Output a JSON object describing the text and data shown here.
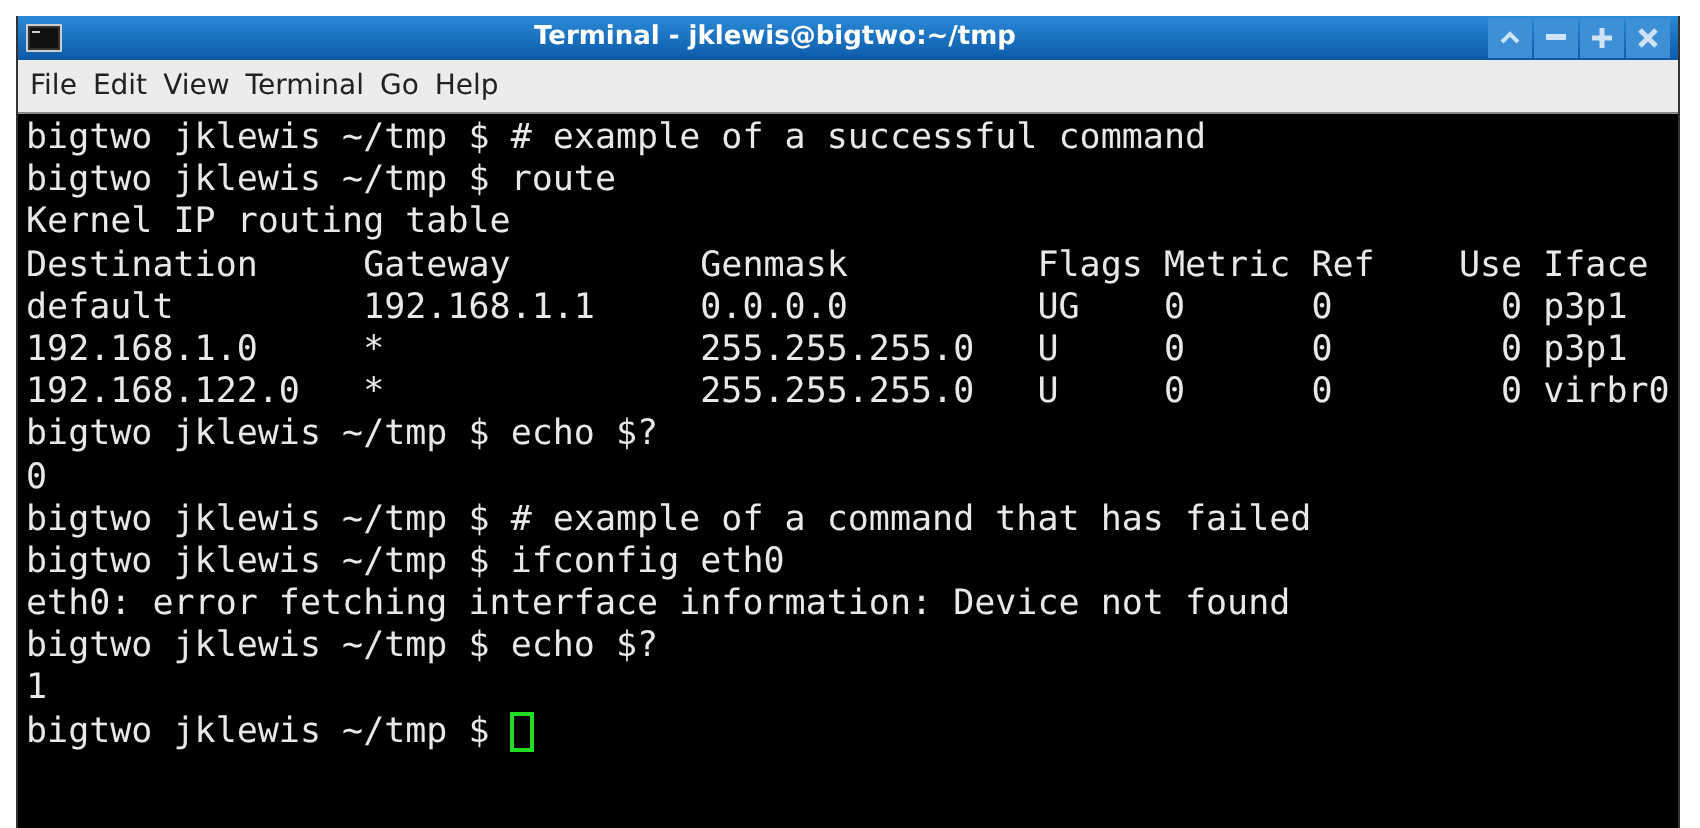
{
  "window": {
    "title": "Terminal - jklewis@bigtwo:~/tmp"
  },
  "menu": [
    "File",
    "Edit",
    "View",
    "Terminal",
    "Go",
    "Help"
  ],
  "terminal": {
    "lines": [
      "bigtwo jklewis ~/tmp $ # example of a successful command",
      "bigtwo jklewis ~/tmp $ route",
      "Kernel IP routing table",
      "Destination     Gateway         Genmask         Flags Metric Ref    Use Iface",
      "default         192.168.1.1     0.0.0.0         UG    0      0        0 p3p1",
      "192.168.1.0     *               255.255.255.0   U     0      0        0 p3p1",
      "192.168.122.0   *               255.255.255.0   U     0      0        0 virbr0",
      "bigtwo jklewis ~/tmp $ echo $?",
      "0",
      "bigtwo jklewis ~/tmp $ # example of a command that has failed",
      "bigtwo jklewis ~/tmp $ ifconfig eth0",
      "eth0: error fetching interface information: Device not found",
      "bigtwo jklewis ~/tmp $ echo $?",
      "1"
    ],
    "prompt": "bigtwo jklewis ~/tmp $"
  }
}
